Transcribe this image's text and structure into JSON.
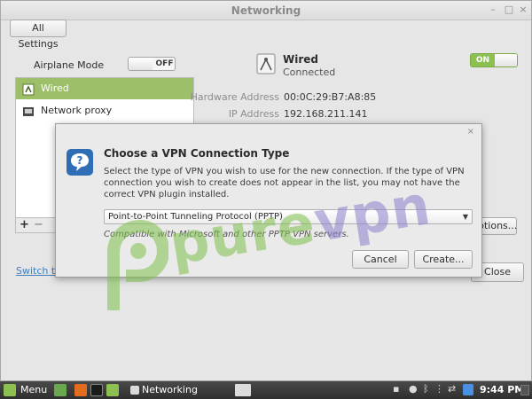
{
  "window": {
    "title": "Networking",
    "all_settings_label": "All Settings",
    "airplane_mode_label": "Airplane Mode",
    "airplane_mode_state": "OFF",
    "switch_link": "Switch to",
    "close_label": "Close",
    "options_label": "ptions..."
  },
  "sidebar": {
    "items": [
      {
        "label": "Wired",
        "icon": "wired-network-icon",
        "selected": true
      },
      {
        "label": "Network proxy",
        "icon": "proxy-icon",
        "selected": false
      }
    ],
    "add_label": "+",
    "remove_label": "−"
  },
  "connection": {
    "name": "Wired",
    "status": "Connected",
    "toggle_state": "ON",
    "hardware_label": "Hardware Address",
    "hardware_value": "00:0C:29:B7:A8:85",
    "ip_label": "IP Address",
    "ip_value": "192.168.211.141"
  },
  "dialog": {
    "title": "Choose a VPN Connection Type",
    "body": "Select the type of VPN you wish to use for the new connection.  If the type of VPN connection you wish to create does not appear in the list, you may not have the correct VPN plugin installed.",
    "selected_type": "Point-to-Point Tunneling Protocol (PPTP)",
    "compat_note": "Compatible with Microsoft and other PPTP VPN servers.",
    "cancel_label": "Cancel",
    "create_label": "Create...",
    "close_glyph": "×"
  },
  "watermark": {
    "brand_a": "pure",
    "brand_b": "vpn"
  },
  "taskbar": {
    "menu_label": "Menu",
    "task_label": "Networking",
    "clock": "9:44 PM"
  },
  "colors": {
    "accent_green": "#8cc152",
    "selection_green": "#9dbf6a",
    "dialog_icon_blue": "#2f6db5"
  }
}
